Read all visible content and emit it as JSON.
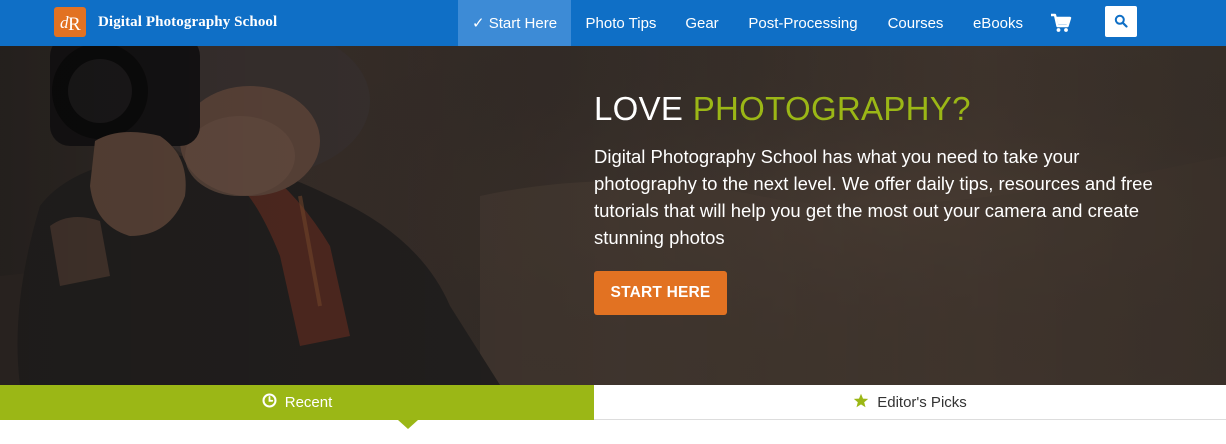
{
  "brand": {
    "logo_mark": "dPS",
    "name": "Digital Photography School",
    "color": "#e27222"
  },
  "nav": {
    "items": [
      {
        "label": "✓ Start Here",
        "active": true
      },
      {
        "label": "Photo Tips"
      },
      {
        "label": "Gear"
      },
      {
        "label": "Post-Processing"
      },
      {
        "label": "Courses"
      },
      {
        "label": "eBooks"
      }
    ],
    "cart_icon": "cart-icon",
    "search_icon": "search-icon",
    "bar_color": "#0f6fc6"
  },
  "hero": {
    "title_prefix": "LOVE ",
    "title_accent": "PHOTOGRAPHY?",
    "accent_color": "#9bb716",
    "description": "Digital Photography School has what you need to take your photography to the next level. We offer daily tips, resources and free tutorials that will help you get the most out your camera and create stunning photos",
    "cta_label": "START HERE"
  },
  "tabs": [
    {
      "label": "Recent",
      "icon": "clock-icon",
      "active": true
    },
    {
      "label": "Editor's Picks",
      "icon": "star-icon"
    }
  ]
}
